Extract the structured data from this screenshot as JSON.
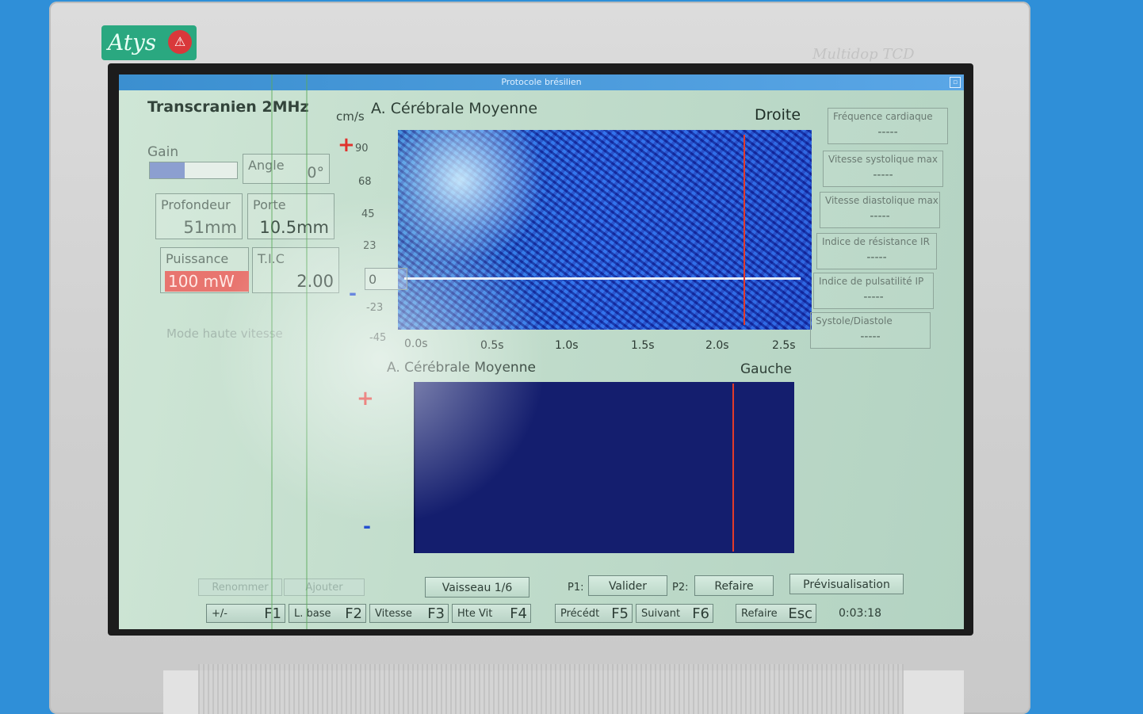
{
  "window": {
    "title": "Protocole brésilien",
    "close_icon": "▫"
  },
  "brand": {
    "logo_text": "Atys",
    "logo_mark": "⚠",
    "right_text": "Multidop TCD"
  },
  "probe": {
    "label": "Transcranien 2MHz"
  },
  "params": {
    "gain_label": "Gain",
    "gain_level_percent": 40,
    "angle_label": "Angle",
    "angle_value": "0°",
    "profondeur_label": "Profondeur",
    "profondeur_value": "51mm",
    "porte_label": "Porte",
    "porte_value": "10.5mm",
    "puissance_label": "Puissance",
    "puissance_value": "100 mW",
    "tic_label": "T.I.C",
    "tic_value": "2.00",
    "hv_label": "Mode haute vitesse"
  },
  "top_panel": {
    "unit": "cm/s",
    "vessel": "A. Cérébrale Moyenne",
    "side": "Droite",
    "y_ticks": [
      "90",
      "68",
      "45",
      "23",
      "-23",
      "-45"
    ],
    "x_ticks": [
      "0.0s",
      "0.5s",
      "1.0s",
      "1.5s",
      "2.0s",
      "2.5s"
    ],
    "baseline_value": "0",
    "plus": "+",
    "minus": "-"
  },
  "bottom_panel": {
    "vessel": "A. Cérébrale Moyenne",
    "side": "Gauche",
    "plus": "+",
    "minus": "-"
  },
  "measurements": [
    {
      "label": "Fréquence cardiaque",
      "value": "-----"
    },
    {
      "label": "Vitesse systolique max",
      "value": "-----"
    },
    {
      "label": "Vitesse diastolique max",
      "value": "-----"
    },
    {
      "label": "Indice de résistance IR",
      "value": "-----"
    },
    {
      "label": "Indice de pulsatilité IP",
      "value": "-----"
    },
    {
      "label": "Systole/Diastole",
      "value": "-----"
    }
  ],
  "buttons": {
    "renommer": "Renommer",
    "ajouter": "Ajouter",
    "vaisseau": "Vaisseau 1/6",
    "p1_label": "P1:",
    "valider": "Valider",
    "p2_label": "P2:",
    "refaire": "Refaire",
    "previsualisation": "Prévisualisation"
  },
  "fkeys": [
    {
      "label": "+/-",
      "key": "F1"
    },
    {
      "label": "L. base",
      "key": "F2"
    },
    {
      "label": "Vitesse",
      "key": "F3"
    },
    {
      "label": "Hte Vit",
      "key": "F4"
    },
    {
      "label": "Précédt",
      "key": "F5"
    },
    {
      "label": "Suivant",
      "key": "F6"
    },
    {
      "label": "Refaire",
      "key": "Esc"
    }
  ],
  "timer": "0:03:18"
}
